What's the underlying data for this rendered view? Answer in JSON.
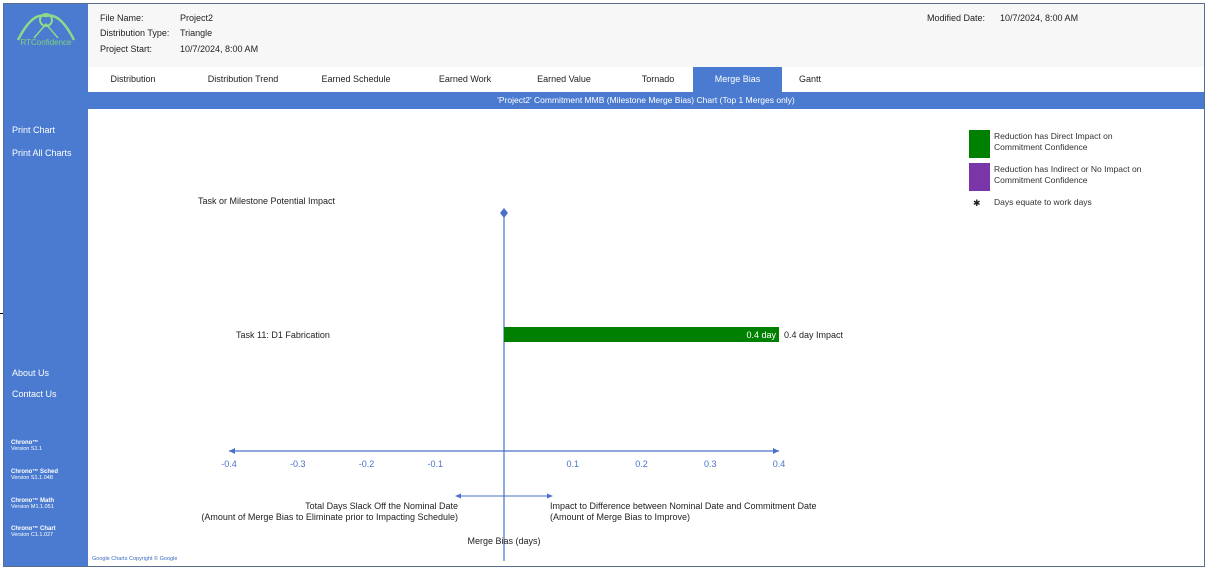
{
  "sidebar": {
    "logo_text": "RTConfidence",
    "links": [
      "Print Chart",
      "Print All Charts",
      "About Us",
      "Contact Us"
    ],
    "versions": [
      {
        "name": "Chrono™",
        "version": "Version S1.1"
      },
      {
        "name": "Chrono™ Sched",
        "version": "Version S1.1.048"
      },
      {
        "name": "Chrono™ Math",
        "version": "Version M1.1.051"
      },
      {
        "name": "Chrono™ Chart",
        "version": "Version C1.1.027"
      }
    ]
  },
  "header": {
    "file_name_label": "File Name:",
    "file_name": "Project2",
    "dist_type_label": "Distribution Type:",
    "dist_type": "Triangle",
    "project_start_label": "Project Start:",
    "project_start": "10/7/2024, 8:00 AM",
    "modified_label": "Modified Date:",
    "modified": "10/7/2024, 8:00 AM"
  },
  "tabs": [
    {
      "label": "Distribution",
      "active": false
    },
    {
      "label": "Distribution Trend",
      "active": false
    },
    {
      "label": "Earned Schedule",
      "active": false
    },
    {
      "label": "Earned Work",
      "active": false
    },
    {
      "label": "Earned Value",
      "active": false
    },
    {
      "label": "Tornado",
      "active": false
    },
    {
      "label": "Merge Bias",
      "active": true
    },
    {
      "label": "Gantt",
      "active": false
    }
  ],
  "chart_title": "'Project2' Commitment MMB (Milestone Merge Bias) Chart (Top 1 Merges only)",
  "legend": [
    {
      "label_line1": "Reduction has Direct Impact on",
      "label_line2": "Commitment Confidence",
      "color": "#008000"
    },
    {
      "label_line1": "Reduction has Indirect or No Impact on",
      "label_line2": "Commitment Confidence",
      "color": "#7a35a8"
    }
  ],
  "legend_note": "Days equate to work days",
  "copyright": "Google Charts Copyright © Google",
  "chart_data": {
    "type": "bar",
    "orientation": "horizontal",
    "category_axis_label": "Task or Milestone Potential Impact",
    "categories": [
      "Task 11: D1 Fabrication"
    ],
    "values": [
      0.4
    ],
    "bar_labels": [
      "0.4 day"
    ],
    "annotations": [
      "0.4 day Impact"
    ],
    "bar_colors": [
      "#008000"
    ],
    "xlim": [
      -0.4,
      0.4
    ],
    "xticks": [
      "-0.4",
      "-0.3",
      "-0.2",
      "-0.1",
      "0.1",
      "0.2",
      "0.3",
      "0.4"
    ],
    "xtick_values": [
      -0.4,
      -0.3,
      -0.2,
      -0.1,
      0.1,
      0.2,
      0.3,
      0.4
    ],
    "xlabel": "Merge Bias (days)",
    "left_caption_line1": "Total Days Slack Off the Nominal Date",
    "left_caption_line2": "(Amount of Merge Bias to Eliminate prior to Impacting Schedule)",
    "right_caption_line1": "Impact to Difference between Nominal Date and Commitment Date",
    "right_caption_line2": "(Amount of Merge Bias to Improve)"
  }
}
